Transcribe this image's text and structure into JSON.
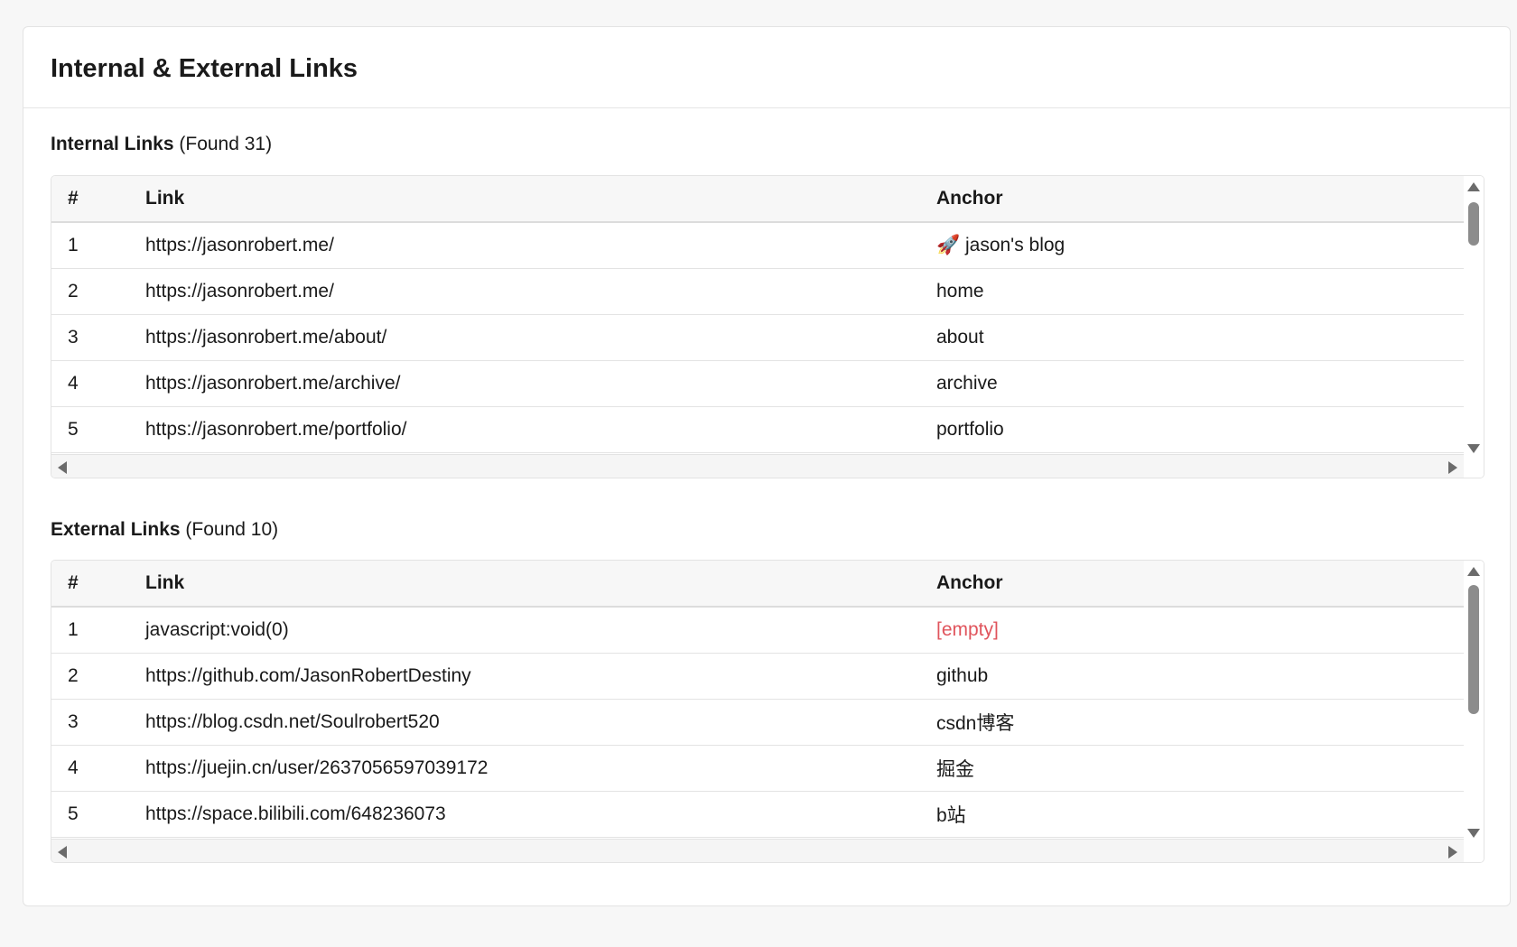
{
  "title": "Internal & External Links",
  "internal": {
    "label": "Internal Links",
    "count_text": "(Found 31)",
    "headers": [
      "#",
      "Link",
      "Anchor"
    ],
    "rows": [
      {
        "num": "1",
        "link": "https://jasonrobert.me/",
        "anchor": "🚀 jason's blog"
      },
      {
        "num": "2",
        "link": "https://jasonrobert.me/",
        "anchor": "home"
      },
      {
        "num": "3",
        "link": "https://jasonrobert.me/about/",
        "anchor": "about"
      },
      {
        "num": "4",
        "link": "https://jasonrobert.me/archive/",
        "anchor": "archive"
      },
      {
        "num": "5",
        "link": "https://jasonrobert.me/portfolio/",
        "anchor": "portfolio"
      }
    ]
  },
  "external": {
    "label": "External Links",
    "count_text": "(Found 10)",
    "headers": [
      "#",
      "Link",
      "Anchor"
    ],
    "rows": [
      {
        "num": "1",
        "link": "javascript:void(0)",
        "anchor": "[empty]",
        "empty": true
      },
      {
        "num": "2",
        "link": "https://github.com/JasonRobertDestiny",
        "anchor": "github"
      },
      {
        "num": "3",
        "link": "https://blog.csdn.net/Soulrobert520",
        "anchor": "csdn博客"
      },
      {
        "num": "4",
        "link": "https://juejin.cn/user/2637056597039172",
        "anchor": "掘金"
      },
      {
        "num": "5",
        "link": "https://space.bilibili.com/648236073",
        "anchor": "b站"
      }
    ]
  },
  "colors": {
    "empty_anchor": "#e0545c",
    "scrollbar_thumb": "#8c8c8c"
  },
  "icons": {
    "scroll_up": "triangle-up",
    "scroll_down": "triangle-down",
    "scroll_left": "triangle-left",
    "scroll_right": "triangle-right"
  }
}
